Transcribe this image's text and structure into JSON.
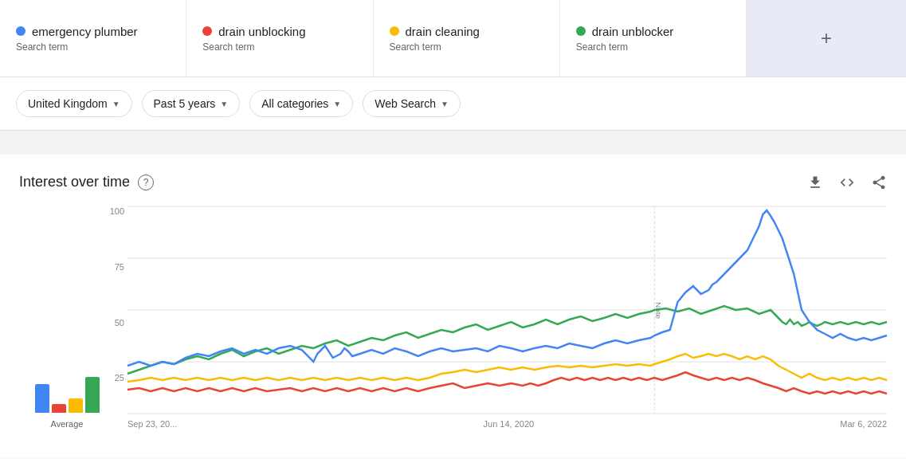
{
  "search_terms": [
    {
      "id": "emergency-plumber",
      "label": "emergency plumber",
      "type": "Search term",
      "color": "#4285F4"
    },
    {
      "id": "drain-unblocking",
      "label": "drain unblocking",
      "type": "Search term",
      "color": "#EA4335"
    },
    {
      "id": "drain-cleaning",
      "label": "drain cleaning",
      "type": "Search term",
      "color": "#FBBC04"
    },
    {
      "id": "drain-unblocker",
      "label": "drain unblocker",
      "type": "Search term",
      "color": "#34A853"
    }
  ],
  "add_button_label": "+",
  "filters": [
    {
      "id": "location",
      "label": "United Kingdom"
    },
    {
      "id": "time",
      "label": "Past 5 years"
    },
    {
      "id": "category",
      "label": "All categories"
    },
    {
      "id": "search_type",
      "label": "Web Search"
    }
  ],
  "chart": {
    "title": "Interest over time",
    "help_icon": "?",
    "actions": {
      "download": "⬇",
      "embed": "<>",
      "share": "⬆"
    },
    "y_labels": [
      "100",
      "75",
      "50",
      "25",
      ""
    ],
    "x_labels": [
      "Sep 23, 20...",
      "Jun 14, 2020",
      "Mar 6, 2022"
    ],
    "note_label": "Note",
    "avg_label": "Average",
    "avg_bars": [
      {
        "color": "#4285F4",
        "height_pct": 60
      },
      {
        "color": "#EA4335",
        "height_pct": 18
      },
      {
        "color": "#FBBC04",
        "height_pct": 30
      },
      {
        "color": "#34A853",
        "height_pct": 75
      }
    ]
  }
}
